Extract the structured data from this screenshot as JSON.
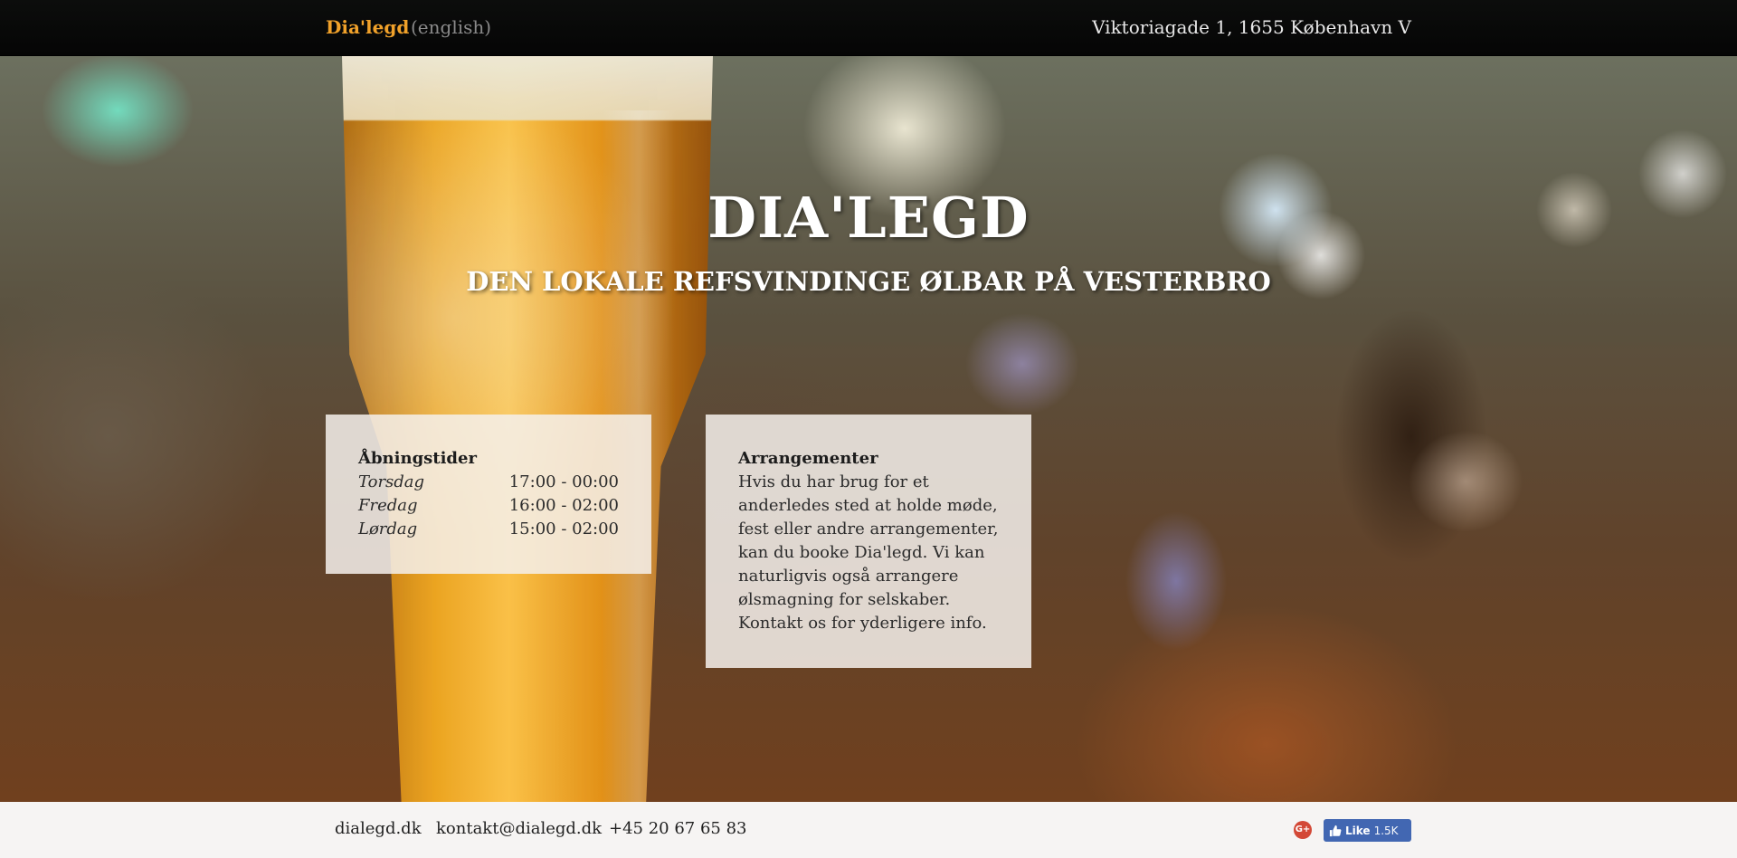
{
  "nav": {
    "brand": "Dia'legd",
    "language_link": "(english)",
    "address": "Viktoriagade 1, 1655 København V"
  },
  "hero": {
    "title": "DIA'LEGD",
    "subtitle": "DEN LOKALE REFSVINDINGE ØLBAR PÅ VESTERBRO"
  },
  "hours": {
    "heading": "Åbningstider",
    "rows": [
      {
        "day": "Torsdag",
        "time": "17:00 - 00:00"
      },
      {
        "day": "Fredag",
        "time": "16:00 - 02:00"
      },
      {
        "day": "Lørdag",
        "time": "15:00 - 02:00"
      }
    ]
  },
  "events": {
    "heading": "Arrangementer",
    "body": "Hvis du har brug for et anderledes sted at holde møde, fest eller andre arrangementer, kan du booke Dia'legd. Vi kan naturligvis også arrangere ølsmagning for selskaber. Kontakt os for yderligere info."
  },
  "footer": {
    "website": "dialegd.dk",
    "email": "kontakt@dialegd.dk",
    "phone": "+45 20 67 65 83",
    "gplus_icon": "google-plus-icon",
    "fb_like_label": "Like",
    "fb_like_count": "1.5K"
  },
  "colors": {
    "brand": "#f0a12a",
    "nav_bg": "#0a0a0a",
    "footer_bg": "#f6f4f3",
    "facebook": "#4267b2",
    "google_plus": "#d34836"
  }
}
